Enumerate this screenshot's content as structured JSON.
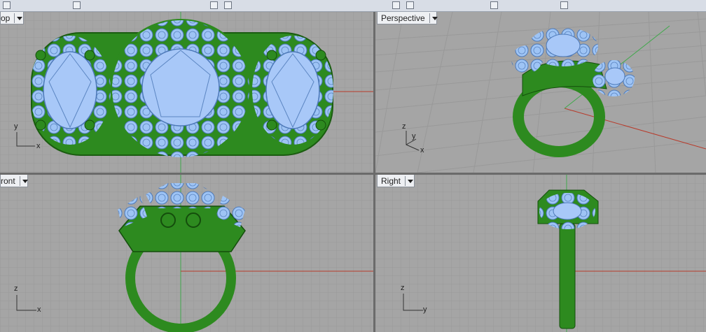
{
  "viewports": {
    "top": {
      "label": "op",
      "axis_v": "y",
      "axis_h": "x"
    },
    "perspective": {
      "label": "Perspective",
      "axis_v": "z",
      "axis_d": "y",
      "axis_h": "x"
    },
    "front": {
      "label": "ront",
      "axis_v": "z",
      "axis_h": "x"
    },
    "right": {
      "label": "Right",
      "axis_v": "z",
      "axis_h": "y"
    }
  },
  "colors": {
    "grid_bg": "#a5a5a5",
    "grid_line": "#999999",
    "model_green": "#2d8a1f",
    "stone_blue": "#9ec4f5",
    "axis_red": "#b83a2a",
    "axis_green": "#3fa84a"
  },
  "icons": [
    "dropdown-arrow-icon"
  ]
}
